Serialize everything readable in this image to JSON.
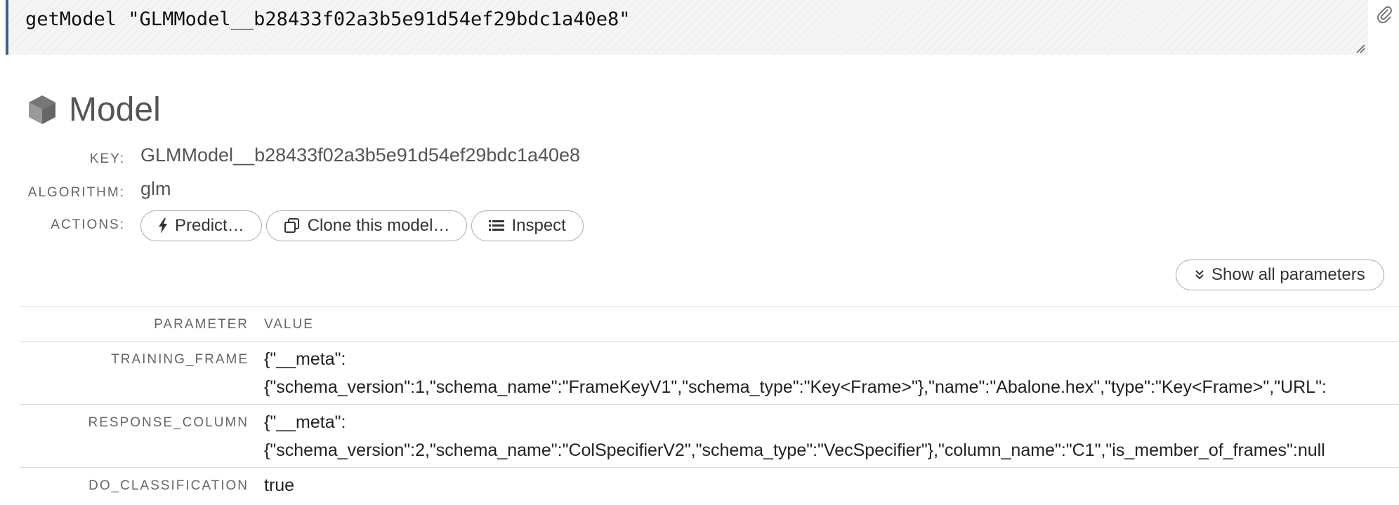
{
  "cell": {
    "code": "getModel \"GLMModel__b28433f02a3b5e91d54ef29bdc1a40e8\"",
    "accent_color": "#3c5e99"
  },
  "model": {
    "title": "Model",
    "icon": "cube-icon",
    "key_label": "KEY:",
    "key_value": "GLMModel__b28433f02a3b5e91d54ef29bdc1a40e8",
    "algorithm_label": "ALGORITHM:",
    "algorithm_value": "glm",
    "actions_label": "ACTIONS:"
  },
  "actions": {
    "predict": {
      "label": "Predict…",
      "icon": "bolt-icon"
    },
    "clone": {
      "label": "Clone this model…",
      "icon": "copy-icon"
    },
    "inspect": {
      "label": "Inspect",
      "icon": "list-icon"
    }
  },
  "show_all": {
    "label": "Show all parameters",
    "icon": "double-chevron-down-icon"
  },
  "params": {
    "header": {
      "name": "PARAMETER",
      "value": "VALUE"
    },
    "rows": [
      {
        "name": "TRAINING_FRAME",
        "value_line1": "{\"__meta\":",
        "value_line2": "{\"schema_version\":1,\"schema_name\":\"FrameKeyV1\",\"schema_type\":\"Key<Frame>\"},\"name\":\"Abalone.hex\",\"type\":\"Key<Frame>\",\"URL\":"
      },
      {
        "name": "RESPONSE_COLUMN",
        "value_line1": "{\"__meta\":",
        "value_line2": "{\"schema_version\":2,\"schema_name\":\"ColSpecifierV2\",\"schema_type\":\"VecSpecifier\"},\"column_name\":\"C1\",\"is_member_of_frames\":null"
      },
      {
        "name": "DO_CLASSIFICATION",
        "value_line1": "true"
      }
    ]
  }
}
